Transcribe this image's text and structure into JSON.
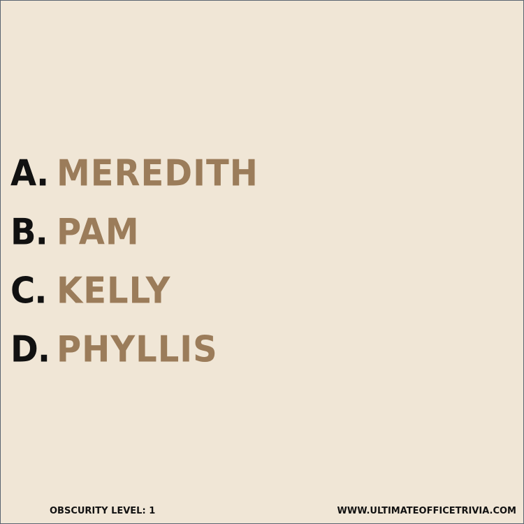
{
  "options": [
    {
      "letter": "A.",
      "answer": "MEREDITH"
    },
    {
      "letter": "B.",
      "answer": "PAM"
    },
    {
      "letter": "C.",
      "answer": "KELLY"
    },
    {
      "letter": "D.",
      "answer": "PHYLLIS"
    }
  ],
  "footer": {
    "obscurity": "OBSCURITY LEVEL: 1",
    "website": "WWW.ULTIMATEOFFICETRIVIA.COM"
  },
  "colors": {
    "background": "#f0e6d6",
    "letter": "#111111",
    "answer": "#9b7c5a"
  }
}
